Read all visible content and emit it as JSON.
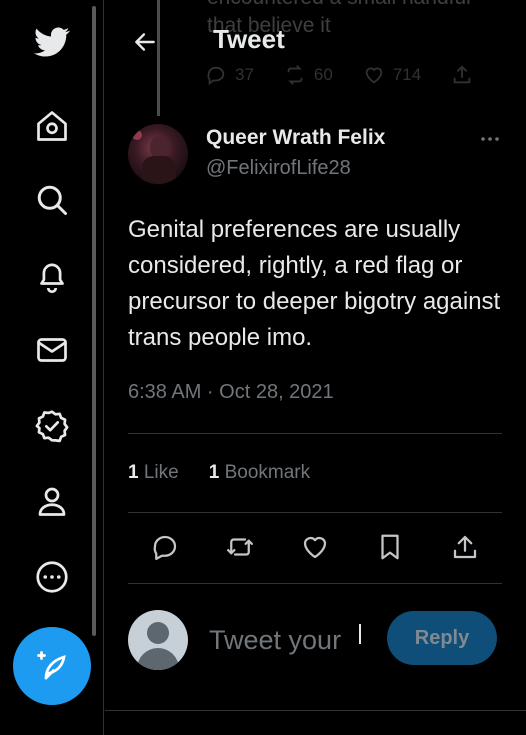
{
  "nav": {
    "items": [
      {
        "name": "twitter-logo-icon"
      },
      {
        "name": "home-icon"
      },
      {
        "name": "explore-icon"
      },
      {
        "name": "notifications-icon"
      },
      {
        "name": "messages-icon"
      },
      {
        "name": "verified-icon"
      },
      {
        "name": "profile-icon"
      },
      {
        "name": "more-icon"
      }
    ],
    "compose_icon": "compose-feather-icon"
  },
  "previous_tweet": {
    "text_line1": "encountered a small handful",
    "text_line2": "that believe it",
    "replies": "37",
    "retweets": "60",
    "likes": "714"
  },
  "header": {
    "title": "Tweet"
  },
  "tweet": {
    "author_name": "Queer Wrath Felix",
    "author_handle": "@FelixirofLife28",
    "text": "Genital preferences are usually considered, rightly, a red flag or precursor to deeper bigotry against trans people imo.",
    "timestamp": "6:38 AM · Oct 28, 2021",
    "likes_count": "1",
    "likes_label": "Like",
    "bookmarks_count": "1",
    "bookmarks_label": "Bookmark"
  },
  "reply": {
    "placeholder": "Tweet your",
    "button_label": "Reply"
  },
  "colors": {
    "background": "#000000",
    "accent": "#1d9bf0",
    "text_primary": "#e7e9ea",
    "text_secondary": "#71767b",
    "divider": "#2f3336"
  }
}
